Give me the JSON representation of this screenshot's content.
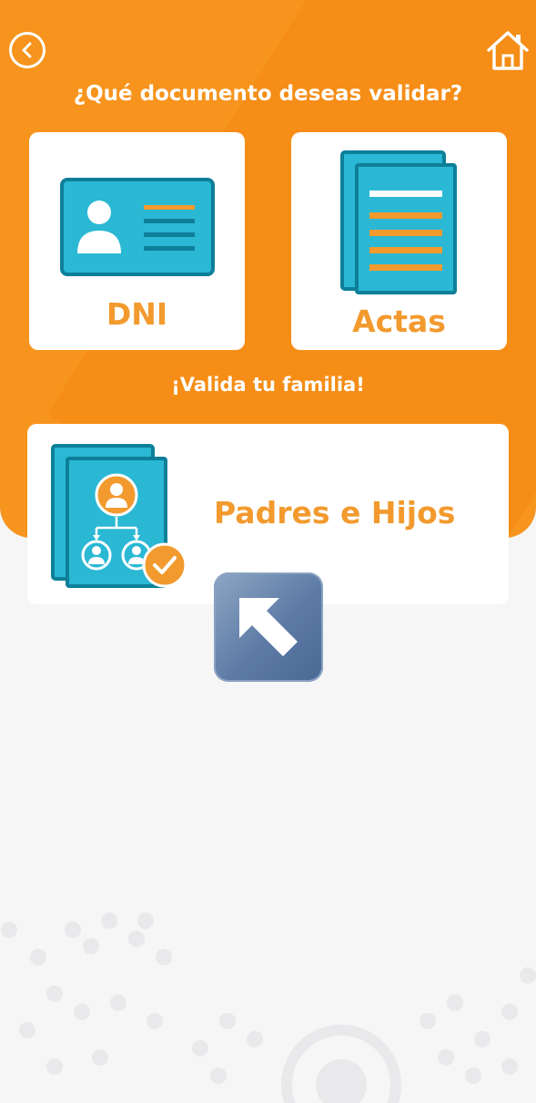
{
  "header": {
    "back_icon": "chevron-left-circle-icon",
    "home_icon": "home-icon",
    "question": "¿Qué documento deseas validar?"
  },
  "cards": {
    "dni_label": "DNI",
    "actas_label": "Actas"
  },
  "family": {
    "heading": "¡Valida tu familia!",
    "card_label": "Padres e Hijos"
  },
  "colors": {
    "brand_orange": "#f7941d",
    "label_orange": "#f29a2e",
    "teal": "#29b6d0",
    "teal_dark": "#0e7f99"
  }
}
